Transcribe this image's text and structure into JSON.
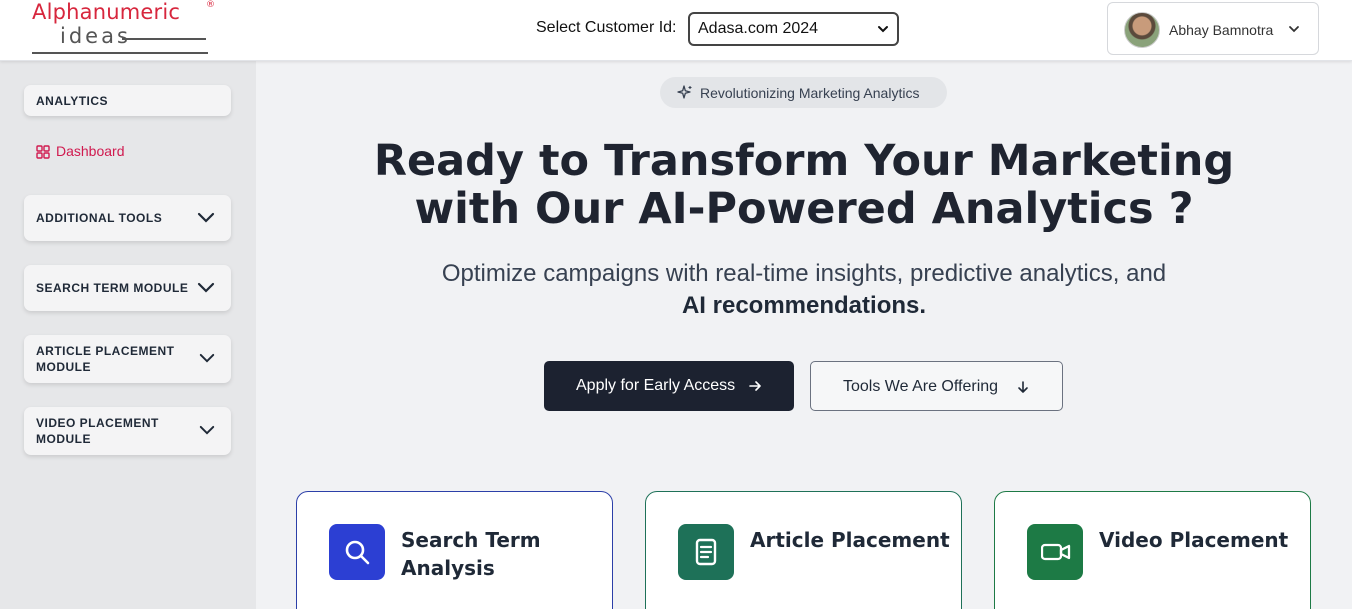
{
  "header": {
    "logo_top": "Alphanumeric",
    "logo_reg": "®",
    "logo_bottom": "ideas",
    "customer_label": "Select Customer Id:",
    "customer_value": "Adasa.com 2024",
    "user_name": "Abhay Bamnotra"
  },
  "sidebar": {
    "analytics_label": "ANALYTICS",
    "dashboard_label": "Dashboard",
    "sections": [
      "ADDITIONAL TOOLS",
      "SEARCH TERM MODULE",
      "ARTICLE PLACEMENT MODULE",
      "VIDEO PLACEMENT MODULE"
    ]
  },
  "hero": {
    "pill": "Revolutionizing Marketing Analytics",
    "title_line1": "Ready to Transform Your Marketing",
    "title_line2": "with Our AI-Powered Analytics ?",
    "subtitle": "Optimize campaigns with real-time insights, predictive analytics, and",
    "subtitle_bold": "AI recommendations.",
    "primary_button": "Apply for Early Access",
    "secondary_button": "Tools We Are Offering"
  },
  "tools": [
    {
      "title": "Search Term Analysis",
      "icon": "search-icon",
      "color": "#2c3fd3",
      "border": "#2c3fa8"
    },
    {
      "title": "Article Placement",
      "icon": "document-icon",
      "color": "#1e7158",
      "border": "#1e7158"
    },
    {
      "title": "Video Placement",
      "icon": "video-icon",
      "color": "#1d7a45",
      "border": "#1d7a45"
    }
  ],
  "colors": {
    "brand_red": "#d7263d",
    "accent_pink": "#d01a4f",
    "dark_button": "#1c2230"
  }
}
